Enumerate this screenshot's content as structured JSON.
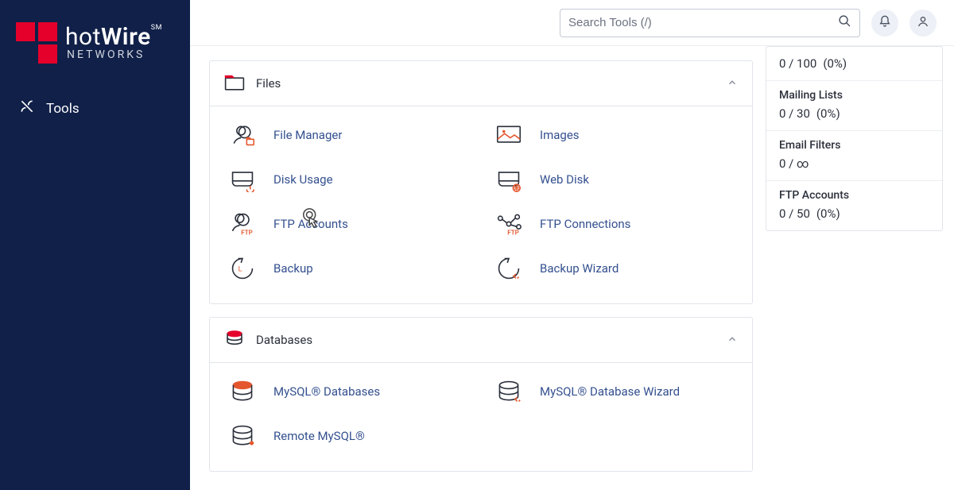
{
  "brand": {
    "line1a": "hot",
    "line1b": "Wire",
    "sm": "SM",
    "line2": "NETWORKS"
  },
  "sidebar": {
    "tools": "Tools"
  },
  "topbar": {
    "search_placeholder": "Search Tools (/)"
  },
  "panel_files": {
    "title": "Files",
    "items": {
      "file_manager": "File Manager",
      "images": "Images",
      "disk_usage": "Disk Usage",
      "web_disk": "Web Disk",
      "ftp_accounts": "FTP Accounts",
      "ftp_connections": "FTP Connections",
      "backup": "Backup",
      "backup_wizard": "Backup Wizard"
    }
  },
  "panel_databases": {
    "title": "Databases",
    "items": {
      "mysql_databases": "MySQL® Databases",
      "mysql_wizard": "MySQL® Database Wizard",
      "remote_mysql": "Remote MySQL®"
    }
  },
  "stats": {
    "s1": {
      "value": "0 / 100",
      "pct": "(0%)"
    },
    "s2": {
      "label": "Mailing Lists",
      "value": "0 / 30",
      "pct": "(0%)"
    },
    "s3": {
      "label": "Email Filters",
      "value": "0 / ∞"
    },
    "s4": {
      "label": "FTP Accounts",
      "value": "0 / 50",
      "pct": "(0%)"
    }
  }
}
